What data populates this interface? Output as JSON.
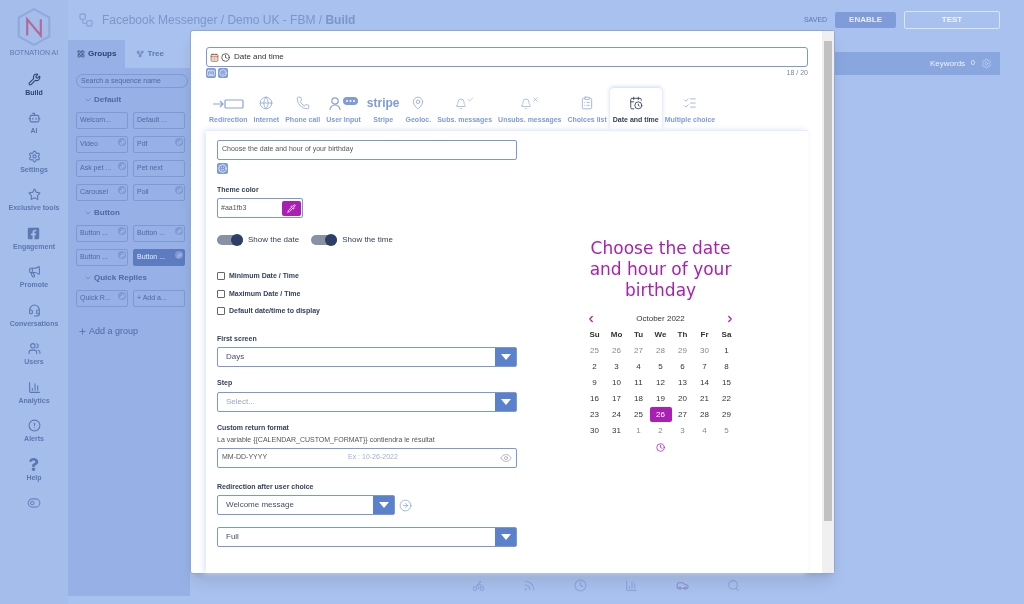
{
  "app": {
    "logo_text": "BOTNATION AI",
    "sidebar": [
      {
        "label": "Build",
        "selected": true
      },
      {
        "label": "AI",
        "selected": false
      },
      {
        "label": "Settings",
        "selected": false
      },
      {
        "label": "Exclusive tools",
        "selected": false
      },
      {
        "label": "Engagement",
        "selected": false
      },
      {
        "label": "Promote",
        "selected": false
      },
      {
        "label": "Conversations",
        "selected": false
      },
      {
        "label": "Users",
        "selected": false
      },
      {
        "label": "Analytics",
        "selected": false
      },
      {
        "label": "Alerts",
        "selected": false
      },
      {
        "label": "Help",
        "selected": false
      }
    ],
    "breadcrumb": {
      "path": "Facebook Messenger / Demo UK - FBM / ",
      "current": "Build"
    },
    "saved": "SAVED",
    "enable": "ENABLE",
    "test": "TEST",
    "panel_tabs": [
      {
        "label": "Groups",
        "selected": true
      },
      {
        "label": "Tree",
        "selected": false
      }
    ],
    "search_placeholder": "Search a sequence name",
    "groups": [
      {
        "title": "Default",
        "chips": [
          {
            "label": "Welcom...",
            "linked": false,
            "selected": false
          },
          {
            "label": "Default ...",
            "linked": false,
            "selected": false
          },
          {
            "label": "Video",
            "linked": true,
            "selected": false
          },
          {
            "label": "Pdf",
            "linked": true,
            "selected": false
          },
          {
            "label": "Ask pet ...",
            "linked": true,
            "selected": false
          },
          {
            "label": "Pet next",
            "linked": false,
            "selected": false
          },
          {
            "label": "Carousel",
            "linked": true,
            "selected": false
          },
          {
            "label": "Poll",
            "linked": true,
            "selected": false
          }
        ]
      },
      {
        "title": "Button",
        "chips": [
          {
            "label": "Button ...",
            "linked": true,
            "selected": false
          },
          {
            "label": "Button ...",
            "linked": true,
            "selected": false
          },
          {
            "label": "Button ...",
            "linked": true,
            "selected": false
          },
          {
            "label": "Button ...",
            "linked": true,
            "selected": true
          }
        ]
      },
      {
        "title": "Quick Replies",
        "chips": [
          {
            "label": "Quick R...",
            "linked": true,
            "selected": false
          },
          {
            "label": "+ Add a...",
            "linked": false,
            "selected": false
          }
        ]
      }
    ],
    "add_group": "Add a group",
    "keywords": "Keywords",
    "keywords_count": "0"
  },
  "modal": {
    "title_field": "Date and time",
    "counter": "18 / 20",
    "tabs": [
      {
        "label": "Redirection",
        "selected": false
      },
      {
        "label": "Internet",
        "selected": false
      },
      {
        "label": "Phone call",
        "selected": false
      },
      {
        "label": "User Input",
        "selected": false
      },
      {
        "label": "Stripe",
        "logo": "stripe",
        "selected": false
      },
      {
        "label": "Geoloc.",
        "selected": false
      },
      {
        "label": "Subs. messages",
        "selected": false
      },
      {
        "label": "Unsubs. messages",
        "selected": false
      },
      {
        "label": "Choices list",
        "selected": false
      },
      {
        "label": "Date and time",
        "selected": true
      },
      {
        "label": "Multiple choice",
        "selected": false
      }
    ],
    "message": "Choose the date and hour of your birthday",
    "theme_color": {
      "label": "Theme color",
      "value": "#aa1fb3"
    },
    "toggles": [
      {
        "label": "Show the date",
        "on": true
      },
      {
        "label": "Show the time",
        "on": true
      }
    ],
    "checkboxes": [
      {
        "label": "Minimum Date / Time",
        "checked": false
      },
      {
        "label": "Maximum Date / Time",
        "checked": false
      },
      {
        "label": "Default date/time to display",
        "checked": false
      }
    ],
    "first_screen": {
      "label": "First screen",
      "value": "Days"
    },
    "step": {
      "label": "Step",
      "placeholder": "Select..."
    },
    "custom_format": {
      "label": "Custom return format",
      "hint": "La variable {{CALENDAR_CUSTOM_FORMAT}} contiendra le résultat",
      "value": "MM-DD-YYYY",
      "example": "Ex : 10-26-2022"
    },
    "redirection": {
      "label": "Redirection after user choice",
      "value": "Welcome message"
    },
    "display": {
      "value": "Full"
    },
    "preview": {
      "title": "Choose the date and hour of your birthday",
      "month": "October 2022",
      "weekdays": [
        "Su",
        "Mo",
        "Tu",
        "We",
        "Th",
        "Fr",
        "Sa"
      ],
      "weeks": [
        [
          {
            "d": "25",
            "muted": true,
            "selected": false
          },
          {
            "d": "26",
            "muted": true,
            "selected": false
          },
          {
            "d": "27",
            "muted": true,
            "selected": false
          },
          {
            "d": "28",
            "muted": true,
            "selected": false
          },
          {
            "d": "29",
            "muted": true,
            "selected": false
          },
          {
            "d": "30",
            "muted": true,
            "selected": false
          },
          {
            "d": "1",
            "muted": false,
            "selected": false
          }
        ],
        [
          {
            "d": "2",
            "muted": false,
            "selected": false
          },
          {
            "d": "3",
            "muted": false,
            "selected": false
          },
          {
            "d": "4",
            "muted": false,
            "selected": false
          },
          {
            "d": "5",
            "muted": false,
            "selected": false
          },
          {
            "d": "6",
            "muted": false,
            "selected": false
          },
          {
            "d": "7",
            "muted": false,
            "selected": false
          },
          {
            "d": "8",
            "muted": false,
            "selected": false
          }
        ],
        [
          {
            "d": "9",
            "muted": false,
            "selected": false
          },
          {
            "d": "10",
            "muted": false,
            "selected": false
          },
          {
            "d": "11",
            "muted": false,
            "selected": false
          },
          {
            "d": "12",
            "muted": false,
            "selected": false
          },
          {
            "d": "13",
            "muted": false,
            "selected": false
          },
          {
            "d": "14",
            "muted": false,
            "selected": false
          },
          {
            "d": "15",
            "muted": false,
            "selected": false
          }
        ],
        [
          {
            "d": "16",
            "muted": false,
            "selected": false
          },
          {
            "d": "17",
            "muted": false,
            "selected": false
          },
          {
            "d": "18",
            "muted": false,
            "selected": false
          },
          {
            "d": "19",
            "muted": false,
            "selected": false
          },
          {
            "d": "20",
            "muted": false,
            "selected": false
          },
          {
            "d": "21",
            "muted": false,
            "selected": false
          },
          {
            "d": "22",
            "muted": false,
            "selected": false
          }
        ],
        [
          {
            "d": "23",
            "muted": false,
            "selected": false
          },
          {
            "d": "24",
            "muted": false,
            "selected": false
          },
          {
            "d": "25",
            "muted": false,
            "selected": false
          },
          {
            "d": "26",
            "muted": false,
            "selected": true
          },
          {
            "d": "27",
            "muted": false,
            "selected": false
          },
          {
            "d": "28",
            "muted": false,
            "selected": false
          },
          {
            "d": "29",
            "muted": false,
            "selected": false
          }
        ],
        [
          {
            "d": "30",
            "muted": false,
            "selected": false
          },
          {
            "d": "31",
            "muted": false,
            "selected": false
          },
          {
            "d": "1",
            "muted": true,
            "selected": false
          },
          {
            "d": "2",
            "muted": true,
            "selected": false
          },
          {
            "d": "3",
            "muted": true,
            "selected": false
          },
          {
            "d": "4",
            "muted": true,
            "selected": false
          },
          {
            "d": "5",
            "muted": true,
            "selected": false
          }
        ]
      ]
    }
  }
}
